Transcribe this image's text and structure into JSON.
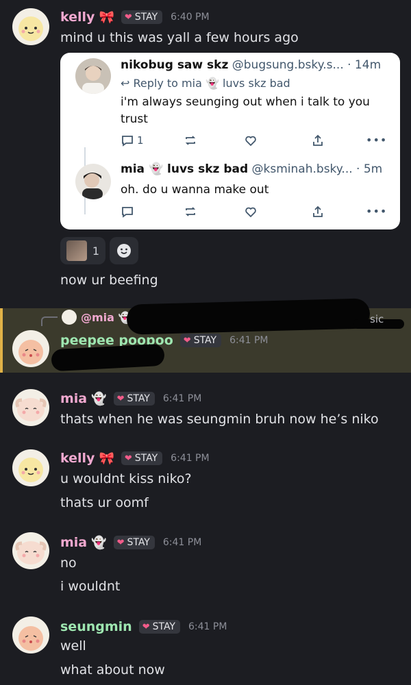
{
  "messages": {
    "m1": {
      "name": "kelly",
      "deco": "🎀",
      "tag": "STAY",
      "time": "6:40 PM",
      "lines": [
        "mind u this was yall a few hours ago"
      ]
    },
    "post1": {
      "name": "nikobug saw skz",
      "handle": "@bugsung.bsky.s...",
      "age": "· 14m",
      "reply_to": "Reply to mia",
      "reply_emoji": "👻",
      "reply_rest": "luvs skz bad",
      "text1": "i'm always seunging out when i talk to you",
      "text2": "trust",
      "reply_count": "1"
    },
    "post2": {
      "name": "mia",
      "name_emoji": "👻",
      "name_rest": "luvs skz bad",
      "handle": "@ksminah.bsky...",
      "age": "· 5m",
      "text": "oh. do u wanna make out"
    },
    "reactions": {
      "count": "1",
      "add_icon": "smile-icon"
    },
    "m1b": {
      "text": "now ur beefing"
    },
    "mention": {
      "text": "@mia",
      "emoji": "👻",
      "partial": "sic"
    },
    "m2": {
      "name": "peepee poopoo",
      "tag": "STAY",
      "time": "6:41 PM"
    },
    "m3": {
      "name": "mia",
      "deco": "👻",
      "tag": "STAY",
      "time": "6:41 PM",
      "lines": [
        "thats when he was seungmin bruh now he’s niko"
      ]
    },
    "m4": {
      "name": "kelly",
      "deco": "🎀",
      "tag": "STAY",
      "time": "6:41 PM",
      "lines": [
        "u wouldnt kiss niko?",
        "thats ur oomf"
      ]
    },
    "m5": {
      "name": "mia",
      "deco": "👻",
      "tag": "STAY",
      "time": "6:41 PM",
      "lines": [
        "no",
        "i wouldnt"
      ]
    },
    "m6": {
      "name": "seungmin",
      "tag": "STAY",
      "time": "6:41 PM",
      "lines": [
        "well",
        "what about now"
      ]
    }
  },
  "colors": {
    "background": "#1c1d22",
    "name_pink": "#f0a8cf",
    "name_green": "#9ee6b0",
    "highlight": "#3b3a2c",
    "highlight_bar": "#e0b247"
  }
}
